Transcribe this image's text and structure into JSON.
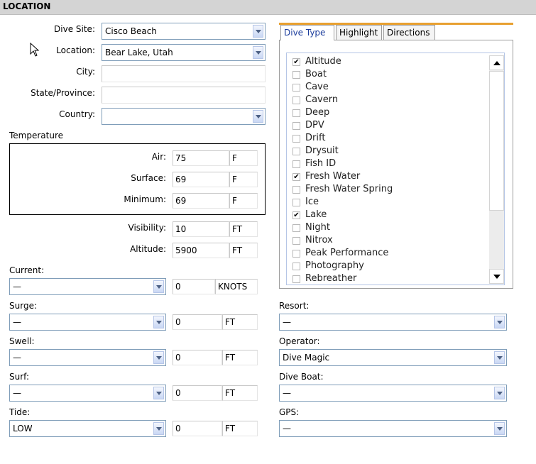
{
  "section": {
    "title": "LOCATION"
  },
  "location": {
    "dive_site": {
      "label": "Dive Site:",
      "value": "Cisco Beach"
    },
    "location": {
      "label": "Location:",
      "value": "Bear Lake, Utah"
    },
    "city": {
      "label": "City:",
      "value": ""
    },
    "state": {
      "label": "State/Province:",
      "value": ""
    },
    "country": {
      "label": "Country:",
      "value": ""
    }
  },
  "temperature": {
    "label": "Temperature",
    "air": {
      "label": "Air:",
      "value": "75",
      "unit": "F"
    },
    "surface": {
      "label": "Surface:",
      "value": "69",
      "unit": "F"
    },
    "minimum": {
      "label": "Minimum:",
      "value": "69",
      "unit": "F"
    }
  },
  "visibility": {
    "label": "Visibility:",
    "value": "10",
    "unit": "FT"
  },
  "altitude": {
    "label": "Altitude:",
    "value": "5900",
    "unit": "FT"
  },
  "conditions": {
    "current": {
      "label": "Current:",
      "select": "—",
      "value": "0",
      "unit": "KNOTS"
    },
    "surge": {
      "label": "Surge:",
      "select": "—",
      "value": "0",
      "unit": "FT"
    },
    "swell": {
      "label": "Swell:",
      "select": "—",
      "value": "0",
      "unit": "FT"
    },
    "surf": {
      "label": "Surf:",
      "select": "—",
      "value": "0",
      "unit": "FT"
    },
    "tide": {
      "label": "Tide:",
      "select": "LOW",
      "value": "0",
      "unit": "FT"
    }
  },
  "right": {
    "resort": {
      "label": "Resort:",
      "value": "—"
    },
    "operator": {
      "label": "Operator:",
      "value": "Dive Magic"
    },
    "dive_boat": {
      "label": "Dive Boat:",
      "value": "—"
    },
    "gps": {
      "label": "GPS:",
      "value": "—"
    }
  },
  "tabs": [
    "Dive Type",
    "Highlight",
    "Directions"
  ],
  "check_mark": "✔",
  "dive_types": [
    {
      "label": "Altitude",
      "checked": true
    },
    {
      "label": "Boat",
      "checked": false
    },
    {
      "label": "Cave",
      "checked": false
    },
    {
      "label": "Cavern",
      "checked": false
    },
    {
      "label": "Deep",
      "checked": false
    },
    {
      "label": "DPV",
      "checked": false
    },
    {
      "label": "Drift",
      "checked": false
    },
    {
      "label": "Drysuit",
      "checked": false
    },
    {
      "label": "Fish ID",
      "checked": false
    },
    {
      "label": "Fresh Water",
      "checked": true
    },
    {
      "label": "Fresh Water Spring",
      "checked": false
    },
    {
      "label": "Ice",
      "checked": false
    },
    {
      "label": "Lake",
      "checked": true
    },
    {
      "label": "Night",
      "checked": false
    },
    {
      "label": "Nitrox",
      "checked": false
    },
    {
      "label": "Peak Performance",
      "checked": false
    },
    {
      "label": "Photography",
      "checked": false
    },
    {
      "label": "Rebreather",
      "checked": false
    }
  ],
  "icons": {
    "cursor": "arrow-cursor-icon",
    "dropdown": "chevron-down-icon",
    "scroll_up": "scroll-up-icon",
    "scroll_down": "scroll-down-icon"
  }
}
